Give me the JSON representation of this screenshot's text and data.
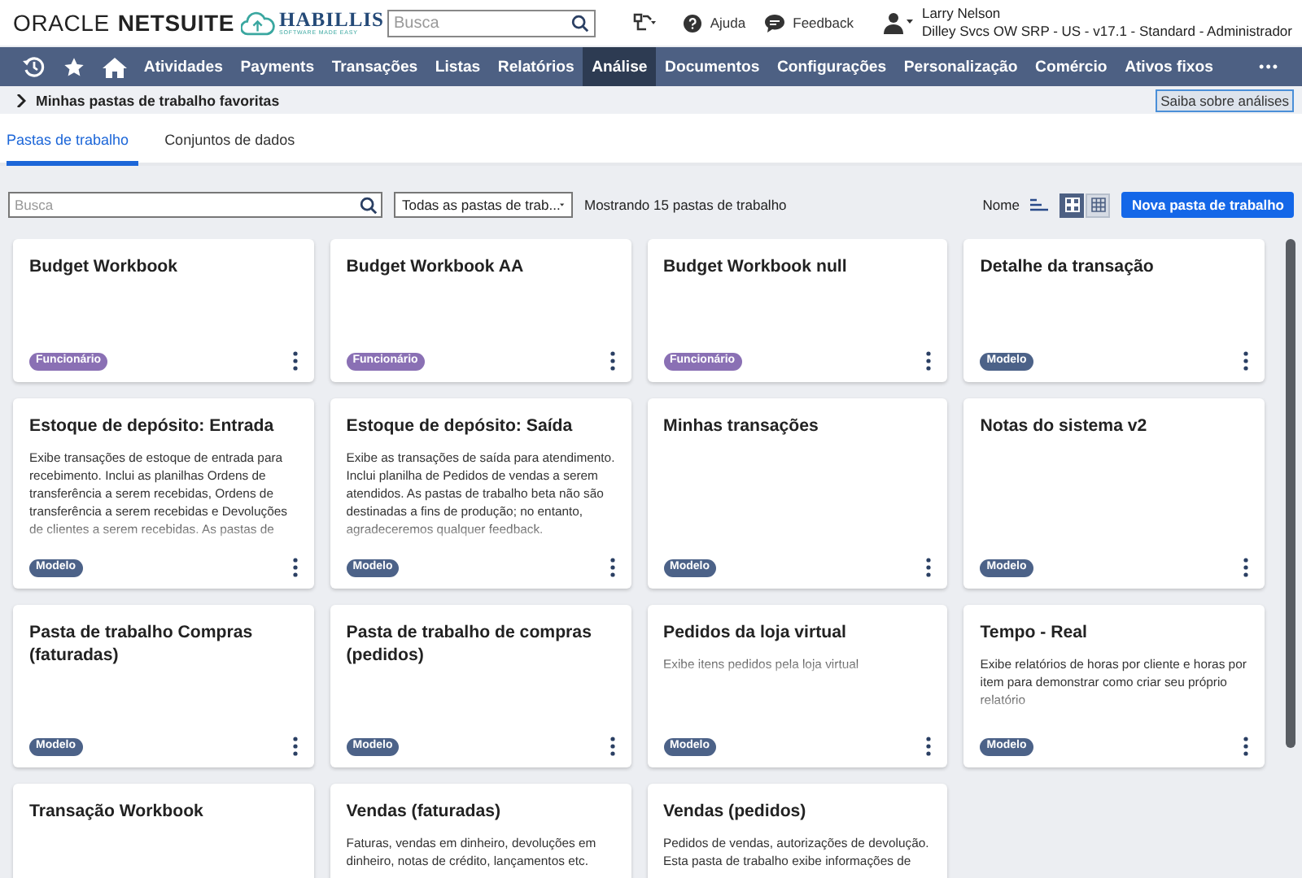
{
  "header": {
    "brand": {
      "first": "ORACLE",
      "second": "NETSUITE"
    },
    "partner": {
      "name": "HABILLIS",
      "tagline": "SOFTWARE MADE EASY"
    },
    "search": {
      "placeholder": "Busca"
    },
    "links": [
      {
        "kind": "help",
        "label": "Ajuda"
      },
      {
        "kind": "feedback",
        "label": "Feedback"
      }
    ],
    "user": {
      "name": "Larry Nelson",
      "account": "Dilley Svcs OW SRP - US - v17.1 - Standard - Administrador"
    }
  },
  "nav": {
    "more": "•••",
    "items": [
      {
        "label": "Atividades",
        "selected": false
      },
      {
        "label": "Payments",
        "selected": false
      },
      {
        "label": "Transações",
        "selected": false
      },
      {
        "label": "Listas",
        "selected": false
      },
      {
        "label": "Relatórios",
        "selected": false
      },
      {
        "label": "Análise",
        "selected": true
      },
      {
        "label": "Documentos",
        "selected": false
      },
      {
        "label": "Configurações",
        "selected": false
      },
      {
        "label": "Personalização",
        "selected": false
      },
      {
        "label": "Comércio",
        "selected": false
      },
      {
        "label": "Ativos fixos",
        "selected": false
      }
    ]
  },
  "favorites": {
    "label": "Minhas pastas de trabalho favoritas",
    "expanded": false,
    "help_button": "Saiba sobre análises"
  },
  "tabs": [
    {
      "label": "Pastas de trabalho",
      "selected": true
    },
    {
      "label": "Conjuntos de dados",
      "selected": false
    }
  ],
  "toolbar": {
    "search": {
      "placeholder": "Busca"
    },
    "filter": "Todas as pastas de trab...",
    "count": "Mostrando 15 pastas de trabalho",
    "sort": "Nome",
    "views": [
      {
        "kind": "grid",
        "selected": true
      },
      {
        "kind": "table",
        "selected": false
      }
    ],
    "new_button": "Nova pasta de trabalho"
  },
  "cards": [
    {
      "title": "Budget Workbook",
      "tag": {
        "label": "Funcionário",
        "color": "#8a70b4"
      }
    },
    {
      "title": "Budget Workbook AA",
      "tag": {
        "label": "Funcionário",
        "color": "#8a70b4"
      }
    },
    {
      "title": "Budget Workbook null",
      "tag": {
        "label": "Funcionário",
        "color": "#8a70b4"
      }
    },
    {
      "title": "Detalhe da transação",
      "tag": {
        "label": "Modelo",
        "color": "#4c6288"
      }
    },
    {
      "title": "Estoque de depósito: Entrada",
      "description": "Exibe transações de estoque de entrada para recebimento. Inclui as planilhas Ordens de transferência a serem recebidas, Ordens de transferência a serem recebidas e Devoluções de clientes a serem recebidas. As pastas de",
      "tag": {
        "label": "Modelo",
        "color": "#4c6288"
      }
    },
    {
      "title": "Estoque de depósito: Saída",
      "description": "Exibe as transações de saída para atendimento. Inclui planilha de Pedidos de vendas a serem atendidos. As pastas de trabalho beta não são destinadas a fins de produção; no entanto, agradeceremos qualquer feedback.",
      "tag": {
        "label": "Modelo",
        "color": "#4c6288"
      }
    },
    {
      "title": "Minhas transações",
      "tag": {
        "label": "Modelo",
        "color": "#4c6288"
      }
    },
    {
      "title": "Notas do sistema v2",
      "tag": {
        "label": "Modelo",
        "color": "#4c6288"
      }
    },
    {
      "title": "Pasta de trabalho Compras (faturadas)",
      "tag": {
        "label": "Modelo",
        "color": "#4c6288"
      }
    },
    {
      "title": "Pasta de trabalho de compras (pedidos)",
      "tag": {
        "label": "Modelo",
        "color": "#4c6288"
      }
    },
    {
      "title": "Pedidos da loja virtual",
      "description": "Exibe itens pedidos pela loja virtual",
      "tag": {
        "label": "Modelo",
        "color": "#4c6288"
      }
    },
    {
      "title": "Tempo - Real",
      "description": "Exibe relatórios de horas por cliente e horas por item para demonstrar como criar seu próprio relatório",
      "tag": {
        "label": "Modelo",
        "color": "#4c6288"
      }
    },
    {
      "title": "Transação Workbook"
    },
    {
      "title": "Vendas (faturadas)",
      "description": "Faturas, vendas em dinheiro, devoluções em dinheiro, notas de crédito, lançamentos etc."
    },
    {
      "title": "Vendas (pedidos)",
      "description": "Pedidos de vendas, autorizações de devolução. Esta pasta de trabalho exibe informações de"
    }
  ]
}
